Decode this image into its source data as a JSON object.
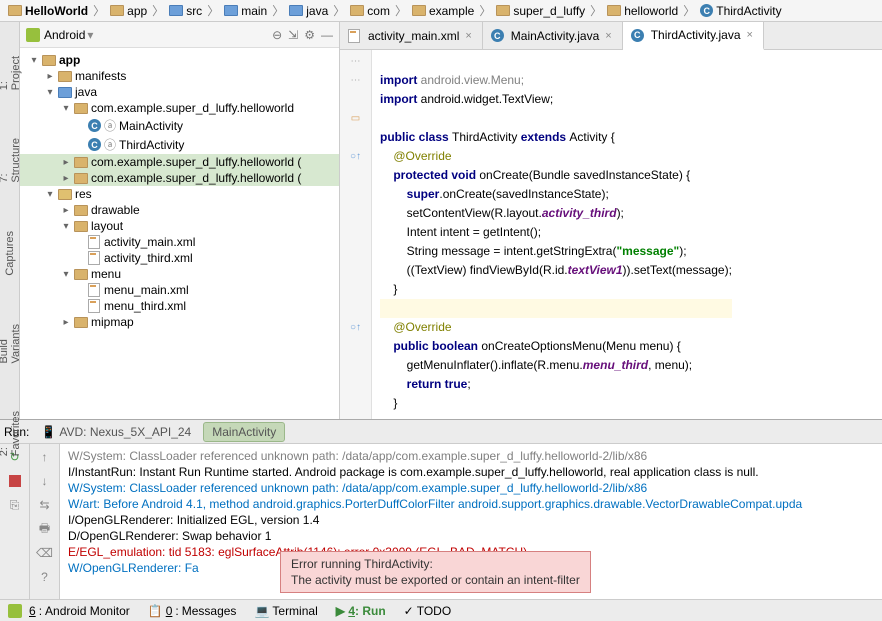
{
  "breadcrumb": [
    "HelloWorld",
    "app",
    "src",
    "main",
    "java",
    "com",
    "example",
    "super_d_luffy",
    "helloworld",
    "ThirdActivity"
  ],
  "project": {
    "header": "Android",
    "tree": {
      "app": "app",
      "manifests": "manifests",
      "java": "java",
      "pkg1": "com.example.super_d_luffy.helloworld",
      "mainActivity": "MainActivity",
      "thirdActivity": "ThirdActivity",
      "pkg2": "com.example.super_d_luffy.helloworld (",
      "pkg3": "com.example.super_d_luffy.helloworld (",
      "res": "res",
      "drawable": "drawable",
      "layout": "layout",
      "activityMainXml": "activity_main.xml",
      "activityThirdXml": "activity_third.xml",
      "menu": "menu",
      "menuMainXml": "menu_main.xml",
      "menuThirdXml": "menu_third.xml",
      "mipmap": "mipmap"
    }
  },
  "tabs": [
    {
      "label": "activity_main.xml",
      "type": "xml"
    },
    {
      "label": "MainActivity.java",
      "type": "class"
    },
    {
      "label": "ThirdActivity.java",
      "type": "class",
      "active": true
    }
  ],
  "code": {
    "l1a": "import ",
    "l1b": "android.view.Menu;",
    "l2a": "import ",
    "l2b": "android.widget.TextView;",
    "l3a": "public class ",
    "l3b": "ThirdActivity ",
    "l3c": "extends ",
    "l3d": "Activity {",
    "l4": "@Override",
    "l5a": "protected void ",
    "l5b": "onCreate(Bundle savedInstanceState) {",
    "l6a": "super",
    "l6b": ".onCreate(savedInstanceState);",
    "l7a": "setContentView(R.layout.",
    "l7b": "activity_third",
    "l7c": ");",
    "l8": "Intent intent = getIntent();",
    "l9a": "String message = intent.getStringExtra(",
    "l9b": "\"message\"",
    "l9c": ");",
    "l10a": "((TextView) findViewById(R.id.",
    "l10b": "textView1",
    "l10c": ")).setText(message);",
    "l11": "}",
    "l12": "@Override",
    "l13a": "public boolean ",
    "l13b": "onCreateOptionsMenu(Menu menu) {",
    "l14a": "getMenuInflater().inflate(R.menu.",
    "l14b": "menu_third",
    "l14c": ", menu);",
    "l15a": "return true",
    "l15b": ";",
    "l16": "}"
  },
  "run": {
    "label": "Run:",
    "tab1": "AVD: Nexus_5X_API_24",
    "tab2": "MainActivity"
  },
  "console_lines": [
    {
      "cls": "log-dim",
      "text": "W/System: ClassLoader referenced unknown path: /data/app/com.example.super_d_luffy.helloworld-2/lib/x86"
    },
    {
      "cls": "log-normal",
      "text": "I/InstantRun: Instant Run Runtime started. Android package is com.example.super_d_luffy.helloworld, real application class is null."
    },
    {
      "cls": "log-blue",
      "text": "W/System: ClassLoader referenced unknown path: /data/app/com.example.super_d_luffy.helloworld-2/lib/x86"
    },
    {
      "cls": "log-blue",
      "text": "W/art: Before Android 4.1, method android.graphics.PorterDuffColorFilter android.support.graphics.drawable.VectorDrawableCompat.upda"
    },
    {
      "cls": "log-normal",
      "text": "I/OpenGLRenderer: Initialized EGL, version 1.4"
    },
    {
      "cls": "log-normal",
      "text": "D/OpenGLRenderer: Swap behavior 1"
    },
    {
      "cls": "log-red",
      "text": "E/EGL_emulation: tid 5183: eglSurfaceAttrib(1146): error 0x3009 (EGL_BAD_MATCH)"
    },
    {
      "cls": "log-blue",
      "text": "W/OpenGLRenderer: Fa                                                        r=EGL_BAD_MATCH"
    }
  ],
  "error": {
    "line1": "Error running ThirdActivity:",
    "line2": "The activity must be exported or contain an intent-filter"
  },
  "statusbar": {
    "android": "Android Monitor",
    "messages": "Messages",
    "terminal": "Terminal",
    "run": "Run",
    "todo": "TODO"
  },
  "rail": {
    "project": "1: Project",
    "structure": "7: Structure",
    "captures": "Captures",
    "buildvar": "Build Variants",
    "favorites": "2: Favorites"
  }
}
